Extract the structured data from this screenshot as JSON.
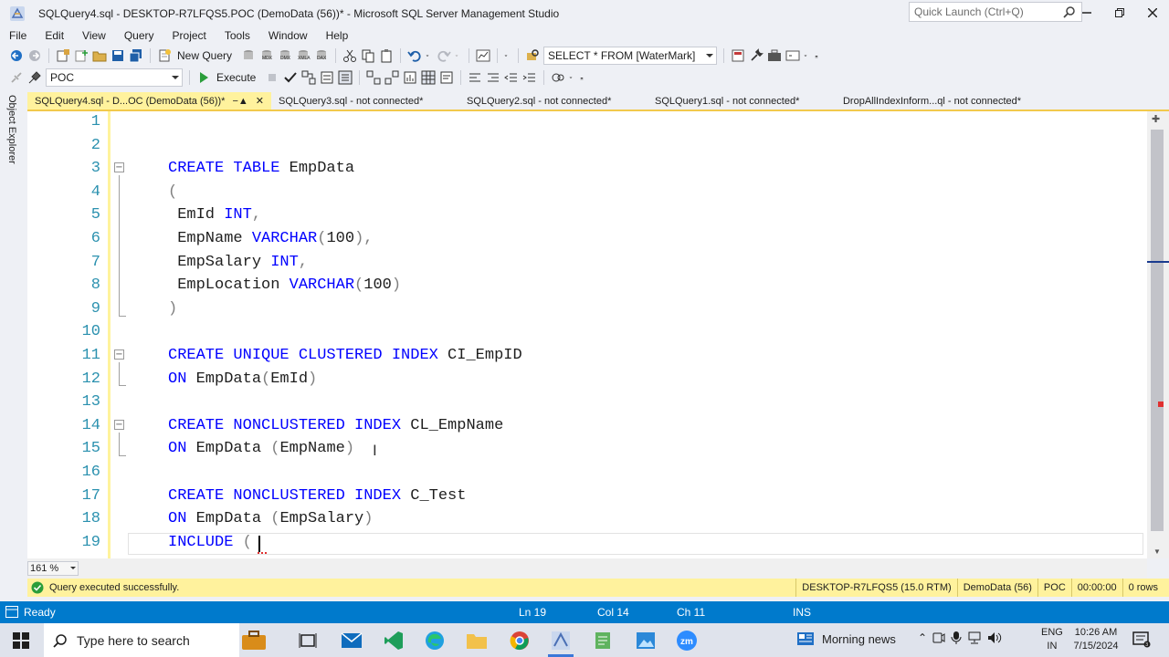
{
  "window": {
    "title": "SQLQuery4.sql - DESKTOP-R7LFQS5.POC (DemoData (56))* - Microsoft SQL Server Management Studio",
    "quick_launch_placeholder": "Quick Launch (Ctrl+Q)"
  },
  "menu": [
    "File",
    "Edit",
    "View",
    "Query",
    "Project",
    "Tools",
    "Window",
    "Help"
  ],
  "toolbar": {
    "new_query_label": "New Query",
    "history_combo_value": "SELECT * FROM [WaterMark]",
    "database_combo_value": "POC",
    "execute_label": "Execute"
  },
  "object_explorer_label": "Object Explorer",
  "tabs": [
    {
      "label": "SQLQuery4.sql - D...OC (DemoData (56))*",
      "active": true
    },
    {
      "label": "SQLQuery3.sql - not connected*",
      "active": false
    },
    {
      "label": "SQLQuery2.sql - not connected*",
      "active": false
    },
    {
      "label": "SQLQuery1.sql - not connected*",
      "active": false
    },
    {
      "label": "DropAllIndexInform...ql - not connected*",
      "active": false
    }
  ],
  "editor": {
    "lines": [
      {
        "n": "1",
        "tokens": []
      },
      {
        "n": "2",
        "tokens": []
      },
      {
        "n": "3",
        "fold": true,
        "tokens": [
          {
            "t": "CREATE TABLE",
            "c": "kw"
          },
          {
            "t": " EmpData",
            "c": "tx"
          }
        ]
      },
      {
        "n": "4",
        "tokens": [
          {
            "t": "(",
            "c": "gr"
          }
        ]
      },
      {
        "n": "5",
        "tokens": [
          {
            "t": " EmId ",
            "c": "tx"
          },
          {
            "t": "INT",
            "c": "kw"
          },
          {
            "t": ",",
            "c": "gr"
          }
        ]
      },
      {
        "n": "6",
        "tokens": [
          {
            "t": " EmpName ",
            "c": "tx"
          },
          {
            "t": "VARCHAR",
            "c": "kw"
          },
          {
            "t": "(",
            "c": "gr"
          },
          {
            "t": "100",
            "c": "tx"
          },
          {
            "t": "),",
            "c": "gr"
          }
        ]
      },
      {
        "n": "7",
        "tokens": [
          {
            "t": " EmpSalary ",
            "c": "tx"
          },
          {
            "t": "INT",
            "c": "kw"
          },
          {
            "t": ",",
            "c": "gr"
          }
        ]
      },
      {
        "n": "8",
        "tokens": [
          {
            "t": " EmpLocation ",
            "c": "tx"
          },
          {
            "t": "VARCHAR",
            "c": "kw"
          },
          {
            "t": "(",
            "c": "gr"
          },
          {
            "t": "100",
            "c": "tx"
          },
          {
            "t": ")",
            "c": "gr"
          }
        ]
      },
      {
        "n": "9",
        "tokens": [
          {
            "t": ")",
            "c": "gr"
          }
        ]
      },
      {
        "n": "10",
        "tokens": []
      },
      {
        "n": "11",
        "fold": true,
        "tokens": [
          {
            "t": "CREATE UNIQUE CLUSTERED INDEX",
            "c": "kw"
          },
          {
            "t": " CI_EmpID",
            "c": "tx"
          }
        ]
      },
      {
        "n": "12",
        "tokens": [
          {
            "t": "ON",
            "c": "kw"
          },
          {
            "t": " EmpData",
            "c": "tx"
          },
          {
            "t": "(",
            "c": "gr"
          },
          {
            "t": "EmId",
            "c": "tx"
          },
          {
            "t": ")",
            "c": "gr"
          }
        ]
      },
      {
        "n": "13",
        "tokens": []
      },
      {
        "n": "14",
        "fold": true,
        "tokens": [
          {
            "t": "CREATE NONCLUSTERED INDEX",
            "c": "kw"
          },
          {
            "t": " CL_EmpName",
            "c": "tx"
          }
        ]
      },
      {
        "n": "15",
        "tokens": [
          {
            "t": "ON",
            "c": "kw"
          },
          {
            "t": " EmpData ",
            "c": "tx"
          },
          {
            "t": "(",
            "c": "gr"
          },
          {
            "t": "EmpName",
            "c": "tx"
          },
          {
            "t": ")",
            "c": "gr"
          }
        ]
      },
      {
        "n": "16",
        "tokens": []
      },
      {
        "n": "17",
        "tokens": [
          {
            "t": "CREATE NONCLUSTERED INDEX",
            "c": "kw"
          },
          {
            "t": " C_Test",
            "c": "tx"
          }
        ]
      },
      {
        "n": "18",
        "tokens": [
          {
            "t": "ON",
            "c": "kw"
          },
          {
            "t": " EmpData ",
            "c": "tx"
          },
          {
            "t": "(",
            "c": "gr"
          },
          {
            "t": "EmpSalary",
            "c": "tx"
          },
          {
            "t": ")",
            "c": "gr"
          }
        ]
      },
      {
        "n": "19",
        "tokens": [
          {
            "t": "INCLUDE",
            "c": "kw"
          },
          {
            "t": " (",
            "c": "gr"
          }
        ]
      }
    ],
    "zoom": "161 %"
  },
  "query_status": {
    "message": "Query executed successfully.",
    "server": "DESKTOP-R7LFQS5 (15.0 RTM)",
    "session": "DemoData (56)",
    "database": "POC",
    "elapsed": "00:00:00",
    "rows": "0 rows"
  },
  "statusbar": {
    "state": "Ready",
    "line": "Ln 19",
    "col": "Col 14",
    "ch": "Ch 11",
    "mode": "INS"
  },
  "taskbar": {
    "search_placeholder": "Type here to search",
    "news_label": "Morning news",
    "lang_top": "ENG",
    "lang_bottom": "IN",
    "time": "10:26 AM",
    "date": "7/15/2024"
  },
  "colors": {
    "keyword": "#0000ff",
    "status_blue": "#007acc",
    "tab_active": "#fff29d",
    "line_numbers": "#2b91af"
  }
}
